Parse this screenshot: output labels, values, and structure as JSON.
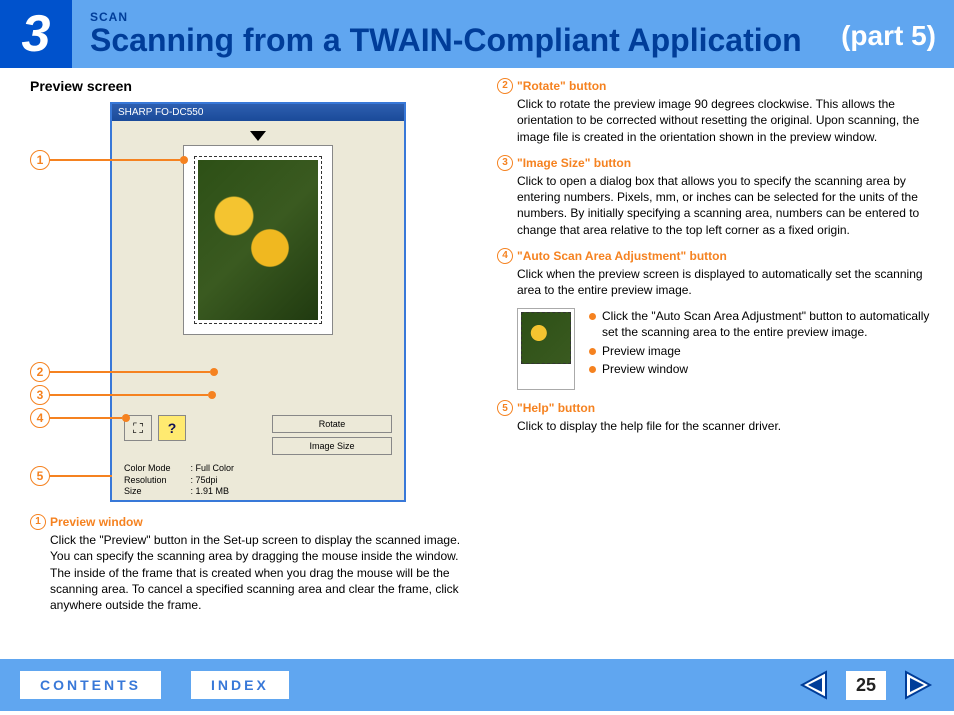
{
  "header": {
    "chapter_num": "3",
    "label": "SCAN",
    "title": "Scanning from a TWAIN-Compliant Application",
    "part": "(part 5)"
  },
  "left": {
    "heading": "Preview screen",
    "window_title": "SHARP FO-DC550",
    "btn_rotate": "Rotate",
    "btn_imagesize": "Image Size",
    "info_labels": "Color Mode\nResolution\nSize",
    "info_values": ": Full Color\n: 75dpi\n: 1.91 MB",
    "item1_title": "Preview window",
    "item1_body": "Click the \"Preview\" button in the Set-up screen to display the scanned image. You can specify the scanning area by dragging the mouse inside the window. The inside of the frame that is created when you drag the mouse will be the scanning area. To cancel a specified scanning area and clear the frame, click anywhere outside the frame."
  },
  "right": {
    "item2_title": "\"Rotate\" button",
    "item2_body": "Click to rotate the preview image 90 degrees clockwise. This allows the orientation to be corrected without resetting the original. Upon scanning, the image file is created in the orientation shown in the preview window.",
    "item3_title": "\"Image Size\" button",
    "item3_body": "Click to open a dialog box that allows you to specify the scanning area by entering numbers. Pixels, mm, or inches can be selected for the units of the numbers. By initially specifying a scanning area, numbers can be entered to change that area relative to the top left corner as a fixed origin.",
    "item4_title": "\"Auto Scan Area Adjustment\" button",
    "item4_body": "Click when the preview screen is displayed to automatically set the scanning area to the entire preview image.",
    "mini_a": "Click the \"Auto Scan Area Adjustment\" button to automatically set the scanning area to the entire preview image.",
    "mini_b": "Preview image",
    "mini_c": "Preview window",
    "item5_title": "\"Help\" button",
    "item5_body": "Click to display the help file for the scanner driver."
  },
  "footer": {
    "contents": "CONTENTS",
    "index": "INDEX",
    "page": "25"
  },
  "callouts": {
    "n1": "1",
    "n2": "2",
    "n3": "3",
    "n4": "4",
    "n5": "5"
  }
}
